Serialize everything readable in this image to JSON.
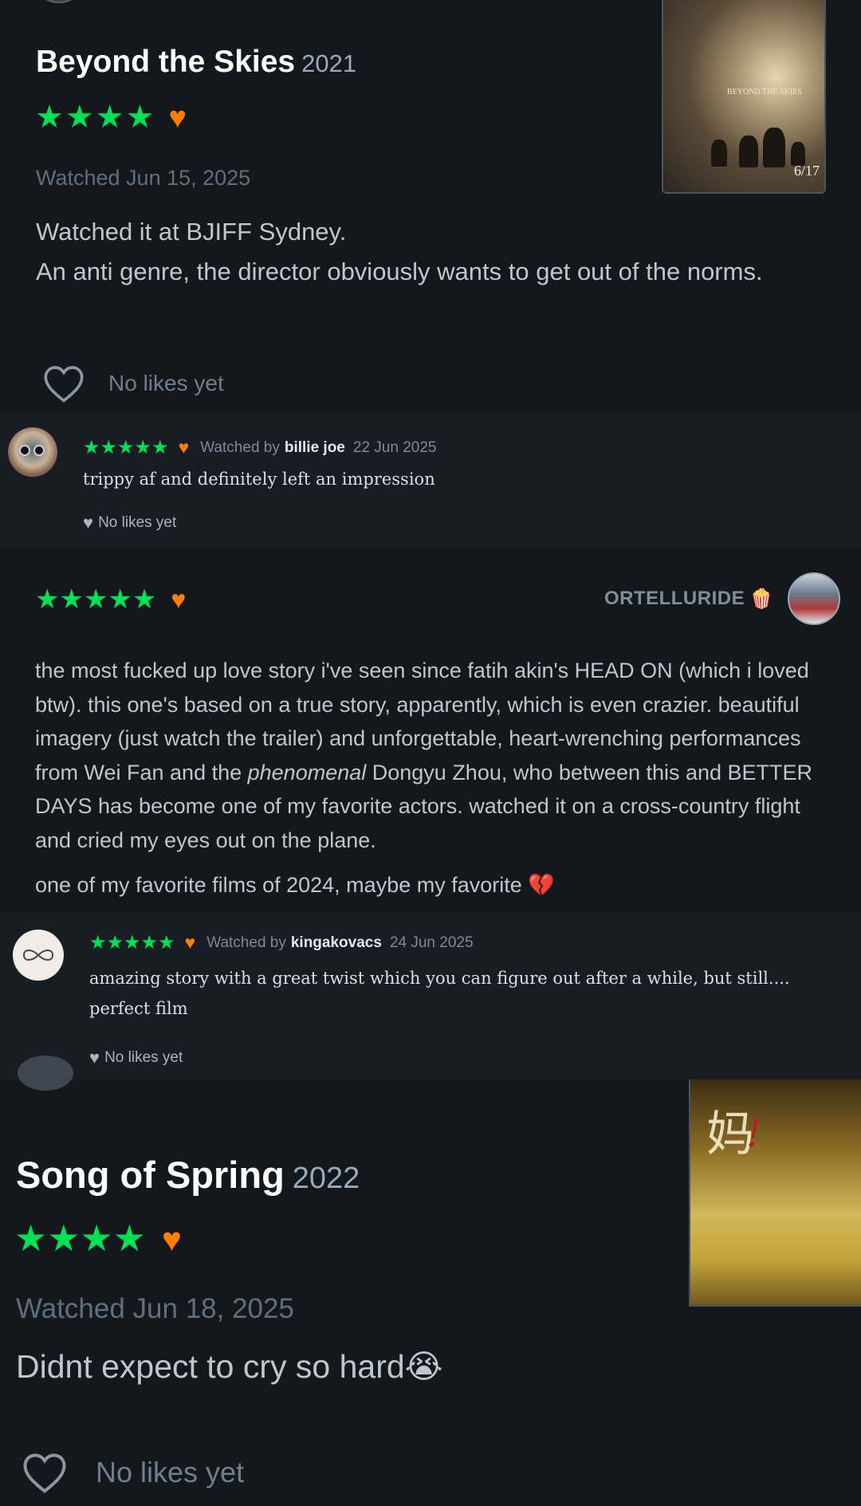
{
  "card1": {
    "title": "Beyond the Skies",
    "year": "2021",
    "stars": "★★★★",
    "liked_icon": "heart-icon",
    "watched": "Watched Jun 15, 2025",
    "review_line1": "Watched it at BJIFF Sydney.",
    "review_line2": "An anti genre, the director obviously wants to get out of the norms.",
    "likes": "No likes yet",
    "poster": {
      "title": "BEYOND THE SKIES",
      "date": "6/17"
    }
  },
  "comment1": {
    "stars": "★★★★★",
    "watched_by": "Watched by",
    "user": "billie joe",
    "date": "22 Jun 2025",
    "text": "trippy af and definitely left an impression",
    "likes": "No likes yet"
  },
  "review2": {
    "stars": "★★★★★",
    "user": "ORTELLURIDE",
    "user_emoji": "🍿",
    "p1_a": "the most fucked up love story i've seen since fatih akin's HEAD ON (which i loved btw). this one's based on a true story, apparently, which is even crazier. beautiful imagery (just watch the trailer) and unforgettable, heart-wrenching performances from Wei Fan and the ",
    "p1_em": "phenomenal",
    "p1_b": " Dongyu Zhou, who between this and BETTER DAYS has become one of my favorite actors. watched it on a cross-country flight and cried my eyes out on the plane.",
    "p2": "one of my favorite films of 2024, maybe my favorite 💔"
  },
  "comment2": {
    "stars": "★★★★★",
    "watched_by": "Watched by",
    "user": "kingakovacs",
    "date": "24 Jun 2025",
    "text": "amazing story with a great twist which you can figure out after a while, but still.... perfect film",
    "likes": "No likes yet"
  },
  "card3": {
    "title": "Song of Spring",
    "year": "2022",
    "stars": "★★★★",
    "watched": "Watched Jun 18, 2025",
    "review": "Didnt expect to cry so hard😭",
    "likes": "No likes yet"
  },
  "colors": {
    "background": "#14181c",
    "comment_bg": "#181d23",
    "star_green": "#00e054",
    "heart_orange": "#ff8000"
  }
}
